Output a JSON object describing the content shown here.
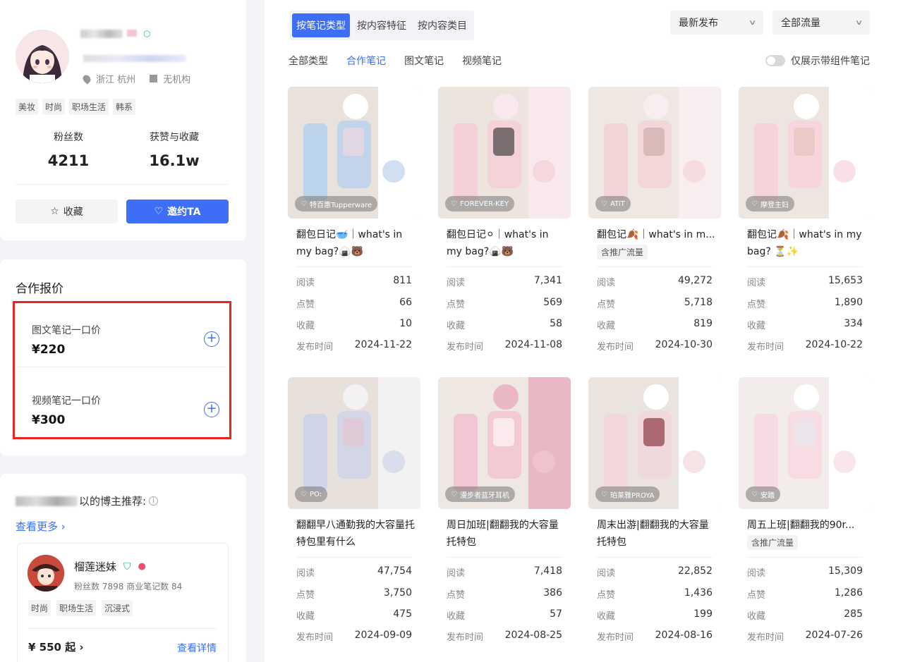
{
  "profile": {
    "location": "浙江 杭州",
    "org": "无机构",
    "tags": [
      "美妆",
      "时尚",
      "职场生活",
      "韩系"
    ],
    "fans_label": "粉丝数",
    "fans_value": "4211",
    "likes_label": "获赞与收藏",
    "likes_value": "16.1w",
    "fav_button": "收藏",
    "invite_button": "邀约TA"
  },
  "pricing": {
    "title": "合作报价",
    "items": [
      {
        "label": "图文笔记一口价",
        "price": "¥220"
      },
      {
        "label": "视频笔记一口价",
        "price": "¥300"
      }
    ]
  },
  "recommend": {
    "title_suffix": "以的博主推荐:",
    "more": "查看更多 ›",
    "creator": {
      "name": "榴莲迷妹",
      "sub": "粉丝数 7898  商业笔记数 84",
      "tags": [
        "时尚",
        "职场生活",
        "沉浸式"
      ],
      "price": "¥ 550 起 ›",
      "detail": "查看详情"
    }
  },
  "filters": {
    "segments": [
      "按笔记类型",
      "按内容特征",
      "按内容类目"
    ],
    "sort": "最新发布",
    "traffic": "全部流量",
    "subtabs": [
      "全部类型",
      "合作笔记",
      "图文笔记",
      "视频笔记"
    ],
    "toggle_label": "仅展示带组件笔记"
  },
  "stat_labels": {
    "read": "阅读",
    "like": "点赞",
    "fav": "收藏",
    "date": "发布时间"
  },
  "notes": [
    {
      "brand": "特百惠Tupperware",
      "title": "翻包日记🥣｜what's in my bag?🍙🐻",
      "promo": "",
      "read": "811",
      "like": "66",
      "fav": "10",
      "date": "2024-11-22"
    },
    {
      "brand": "FOREVER-KEY",
      "title": "翻包日记⚪｜what's in my bag?🍙🐻",
      "promo": "",
      "read": "7,341",
      "like": "569",
      "fav": "58",
      "date": "2024-11-08"
    },
    {
      "brand": "ATiT",
      "title": "翻包记🍂｜what's in m...",
      "promo": "含推广流量",
      "read": "49,272",
      "like": "5,718",
      "fav": "819",
      "date": "2024-10-30"
    },
    {
      "brand": "摩登主妇",
      "title": "翻包记🍂｜what's in my bag? ⏳✨",
      "promo": "",
      "read": "15,653",
      "like": "1,890",
      "fav": "334",
      "date": "2024-10-22"
    },
    {
      "brand": "PO:",
      "title": "翻翻早八通勤我的大容量托特包里有什么",
      "promo": "",
      "read": "47,754",
      "like": "3,750",
      "fav": "475",
      "date": "2024-09-09"
    },
    {
      "brand": "漫步者蓝牙耳机",
      "title": "周日加班|翻翻我的大容量托特包",
      "promo": "",
      "read": "7,418",
      "like": "386",
      "fav": "57",
      "date": "2024-08-25"
    },
    {
      "brand": "珀莱雅PROYA",
      "title": "周末出游|翻翻我的大容量托特包",
      "promo": "",
      "read": "22,852",
      "like": "1,436",
      "fav": "199",
      "date": "2024-08-16"
    },
    {
      "brand": "安踏",
      "title": "周五上班|翻翻我的90r...",
      "promo": "含推广流量",
      "read": "15,309",
      "like": "1,286",
      "fav": "285",
      "date": "2024-07-26"
    }
  ],
  "colors": {
    "accent": "#3d6ef5",
    "highlight_box": "#e8261d"
  }
}
